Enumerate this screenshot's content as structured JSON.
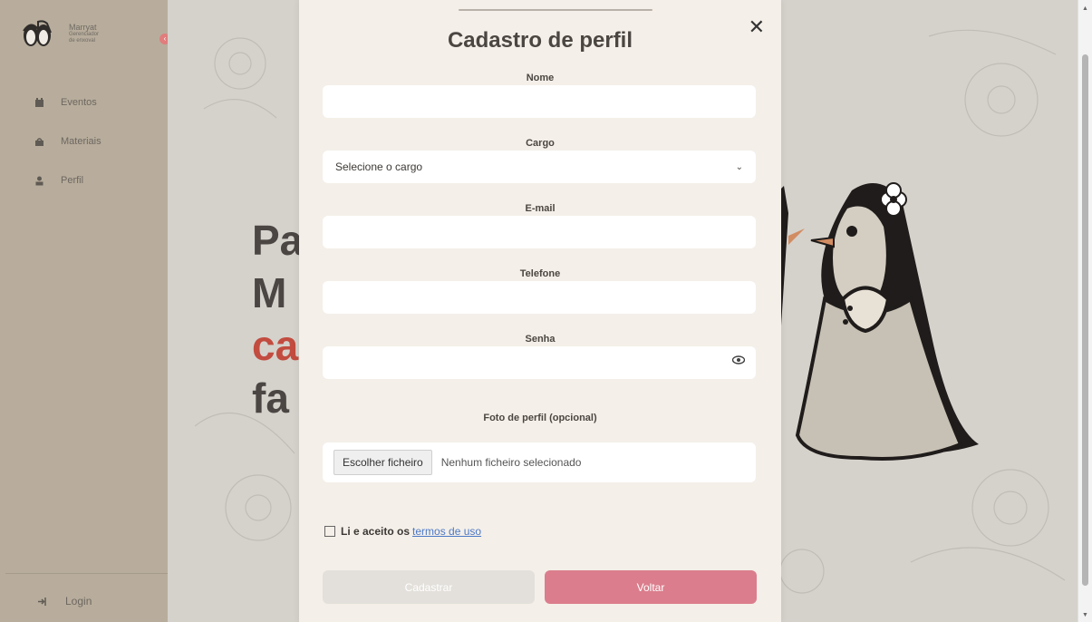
{
  "app": {
    "brand": {
      "name": "Marryat",
      "subtitle_line1": "Gerenciador",
      "subtitle_line2": "de enxoval"
    }
  },
  "sidebar": {
    "items": [
      {
        "label": "Eventos",
        "icon": "calendar-icon"
      },
      {
        "label": "Materiais",
        "icon": "bag-icon"
      },
      {
        "label": "Perfil",
        "icon": "user-icon"
      }
    ],
    "login_label": "Login"
  },
  "background": {
    "hero_line1": "Pa",
    "hero_line2": "M",
    "hero_line3": "ca",
    "hero_line4": "fa"
  },
  "modal": {
    "title": "Cadastro de perfil",
    "fields": {
      "nome_label": "Nome",
      "cargo_label": "Cargo",
      "cargo_value": "Selecione o cargo",
      "email_label": "E-mail",
      "telefone_label": "Telefone",
      "senha_label": "Senha",
      "foto_label": "Foto de perfil (opcional)",
      "file_button": "Escolher ficheiro",
      "file_status": "Nenhum ficheiro selecionado"
    },
    "terms_text": "Li e aceito os",
    "terms_link": "termos de uso",
    "buttons": {
      "submit": "Cadastrar",
      "back": "Voltar"
    }
  },
  "colors": {
    "sidebar": "#b8ad9c",
    "accent": "#db7d8c",
    "hero_accent": "#c24c3f"
  }
}
